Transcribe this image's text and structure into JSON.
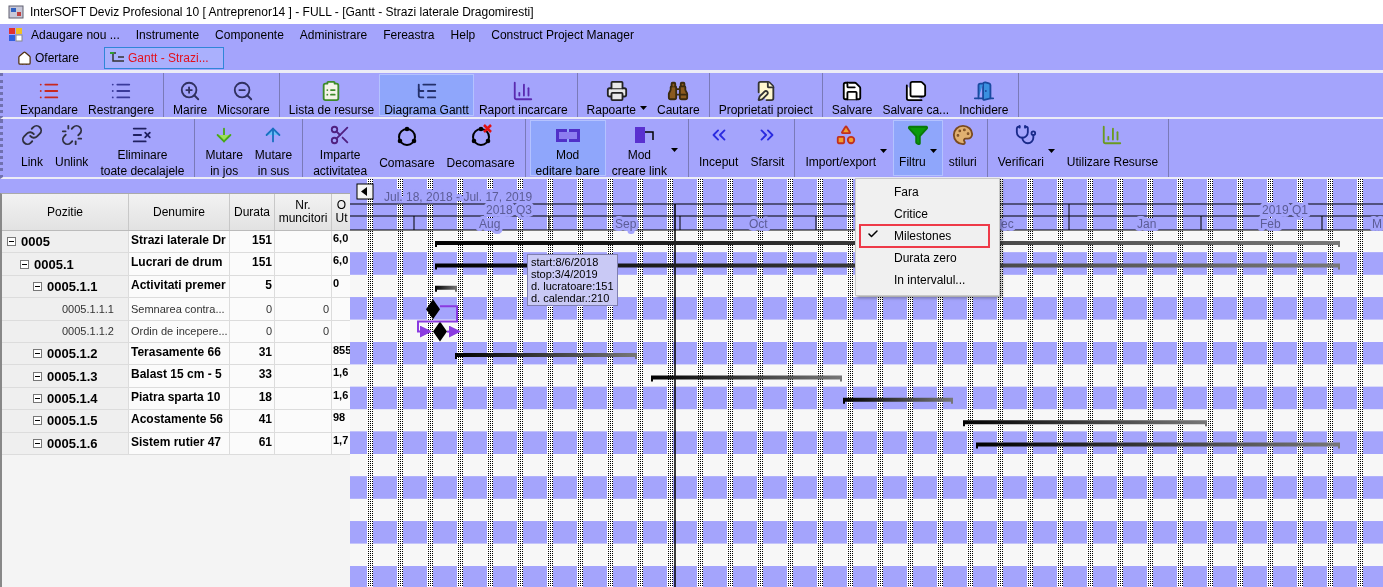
{
  "window": {
    "title": "InterSOFT Deviz Profesional 10 [ Antreprenor14 ] - FULL - [Gantt - Strazi laterale Dragomiresti]"
  },
  "menu_bar": [
    "Adaugare nou ...",
    "Instrumente",
    "Componente",
    "Administrare",
    "Fereastra",
    "Help",
    "Construct Project Manager"
  ],
  "tabs": [
    {
      "label": "Ofertare",
      "selected": false
    },
    {
      "label": "Gantt - Strazi...",
      "selected": true
    }
  ],
  "toolbars": [
    {
      "groups": [
        [
          {
            "label": "Expandare",
            "active": false,
            "dropdown": false
          },
          {
            "label": "Restrangere",
            "active": false,
            "dropdown": false
          }
        ],
        [
          {
            "label": "Marire",
            "active": false,
            "dropdown": false
          },
          {
            "label": "Micsorare",
            "active": false,
            "dropdown": false
          }
        ],
        [
          {
            "label": "Lista de resurse",
            "active": false,
            "dropdown": false
          },
          {
            "label": "Diagrama Gantt",
            "active": true,
            "dropdown": false
          },
          {
            "label": "Raport incarcare",
            "active": false,
            "dropdown": false
          }
        ],
        [
          {
            "label": "Rapoarte",
            "active": false,
            "dropdown": true
          },
          {
            "label": "Cautare",
            "active": false,
            "dropdown": false
          }
        ],
        [
          {
            "label": "Proprietati proiect",
            "active": false,
            "dropdown": false
          }
        ],
        [
          {
            "label": "Salvare",
            "active": false,
            "dropdown": false
          },
          {
            "label": "Salvare ca...",
            "active": false,
            "dropdown": false
          },
          {
            "label": "Inchidere",
            "active": false,
            "dropdown": false
          }
        ]
      ]
    },
    {
      "groups": [
        [
          {
            "label": "Link",
            "active": false,
            "dropdown": false
          },
          {
            "label": "Unlink",
            "active": false,
            "dropdown": false
          },
          {
            "label": "Eliminare\ntoate decalajele",
            "active": false,
            "dropdown": false
          }
        ],
        [
          {
            "label": "Mutare\nin jos",
            "active": false,
            "dropdown": false
          },
          {
            "label": "Mutare\nin sus",
            "active": false,
            "dropdown": false
          }
        ],
        [
          {
            "label": "Imparte\nactivitatea",
            "active": false,
            "dropdown": false
          },
          {
            "label": "Comasare",
            "active": false,
            "dropdown": false
          },
          {
            "label": "Decomasare",
            "active": false,
            "dropdown": false
          }
        ],
        [
          {
            "label": "Mod\neditare bare",
            "active": true,
            "dropdown": false
          },
          {
            "label": "Mod\ncreare link",
            "active": false,
            "dropdown": true
          }
        ],
        [
          {
            "label": "Inceput",
            "active": false,
            "dropdown": false
          },
          {
            "label": "Sfarsit",
            "active": false,
            "dropdown": false
          }
        ],
        [
          {
            "label": "Import/export",
            "active": false,
            "dropdown": true
          },
          {
            "label": "Filtru",
            "active": true,
            "dropdown": true
          },
          {
            "label": "stiluri",
            "active": false,
            "dropdown": false
          }
        ],
        [
          {
            "label": "Verificari",
            "active": false,
            "dropdown": true
          },
          {
            "label": "Utilizare Resurse",
            "active": false,
            "dropdown": false
          }
        ]
      ]
    }
  ],
  "table": {
    "columns": [
      "Pozitie",
      "Denumire",
      "Durata",
      "Nr. muncitori",
      "O Ut"
    ],
    "rows": [
      {
        "kind": "group",
        "pozitie": "0005",
        "denumire": "Strazi laterale Dr",
        "durata": "151",
        "column_5": "6,0",
        "expanded": true,
        "children": [
          {
            "kind": "group",
            "pozitie": "0005.1",
            "denumire": "Lucrari de drum",
            "durata": "151",
            "column_5": "6,0",
            "expanded": true,
            "children": [
              {
                "kind": "group",
                "pozitie": "0005.1.1",
                "denumire": "Activitati premer",
                "durata": "5",
                "column_5": "0",
                "expanded": true,
                "children": [
                  {
                    "kind": "milestone",
                    "pozitie": "0005.1.1.1",
                    "denumire": "Semnarea contra...",
                    "durata": "0",
                    "muncitori": "0"
                  },
                  {
                    "kind": "milestone",
                    "pozitie": "0005.1.1.2",
                    "denumire": "Ordin de incepere...",
                    "durata": "0",
                    "muncitori": "0"
                  }
                ]
              },
              {
                "kind": "group",
                "pozitie": "0005.1.2",
                "denumire": "Terasamente 66",
                "durata": "31",
                "column_5": "855",
                "expanded": true
              },
              {
                "kind": "group",
                "pozitie": "0005.1.3",
                "denumire": "Balast 15 cm - 5",
                "durata": "33",
                "column_5": "1,6",
                "expanded": true
              },
              {
                "kind": "group",
                "pozitie": "0005.1.4",
                "denumire": "Piatra sparta 10",
                "durata": "18",
                "column_5": "1,6",
                "expanded": true
              },
              {
                "kind": "group",
                "pozitie": "0005.1.5",
                "denumire": "Acostamente 56",
                "durata": "41",
                "column_5": "98",
                "expanded": true
              },
              {
                "kind": "group",
                "pozitie": "0005.1.6",
                "denumire": "Sistem rutier 47",
                "durata": "61",
                "column_5": "1,7",
                "expanded": true
              }
            ]
          }
        ]
      }
    ]
  },
  "gantt": {
    "range": "Jul. 18, 2018 - Jul. 17, 2019",
    "quarters": [
      "2018 Q3",
      "2019 Q1"
    ],
    "months": [
      "Aug",
      "Sep",
      "Oct",
      "ec",
      "Jan",
      "Feb",
      "M"
    ]
  },
  "tooltip": {
    "lines": [
      "start:8/6/2018",
      "stop:3/4/2019",
      "d. lucratoare:151",
      "d. calendar.:210"
    ]
  },
  "filter_menu": {
    "items": [
      {
        "label": "Fara",
        "checked": false,
        "selected": false
      },
      {
        "label": "Critice",
        "checked": false,
        "selected": false
      },
      {
        "label": "Milestones",
        "checked": true,
        "selected": true
      },
      {
        "label": "Durata zero",
        "checked": false,
        "selected": false
      },
      {
        "label": "In intervalul...",
        "checked": false,
        "selected": false
      }
    ]
  }
}
